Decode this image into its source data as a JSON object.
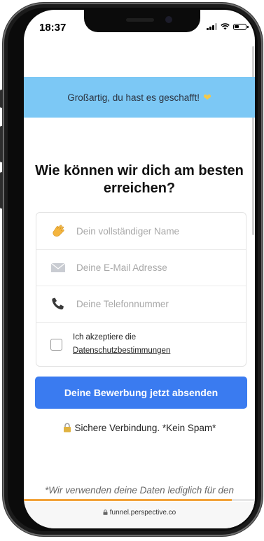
{
  "status_bar": {
    "time": "18:37"
  },
  "banner": {
    "text": "Großartig, du hast es geschafft!"
  },
  "headline": {
    "line1": "Wie können wir dich am besten",
    "line2": "erreichen?"
  },
  "form": {
    "name_placeholder": "Dein vollständiger Name",
    "email_placeholder": "Deine E-Mail Adresse",
    "phone_placeholder": "Deine Telefonnummer",
    "consent_text": "Ich akzeptiere die",
    "consent_link": "Datenschutzbestimmungen",
    "consent_checked": false
  },
  "submit_label": "Deine Bewerbung jetzt absenden",
  "secure_text": "Sichere Verbindung. *Kein Spam*",
  "footnote": "*Wir verwenden deine Daten lediglich für den",
  "progress": {
    "fraction": 0.9,
    "color": "#f2a33a"
  },
  "browser": {
    "url": "funnel.perspective.co"
  },
  "colors": {
    "banner": "#7cc8f5",
    "button": "#3a7bf0"
  }
}
